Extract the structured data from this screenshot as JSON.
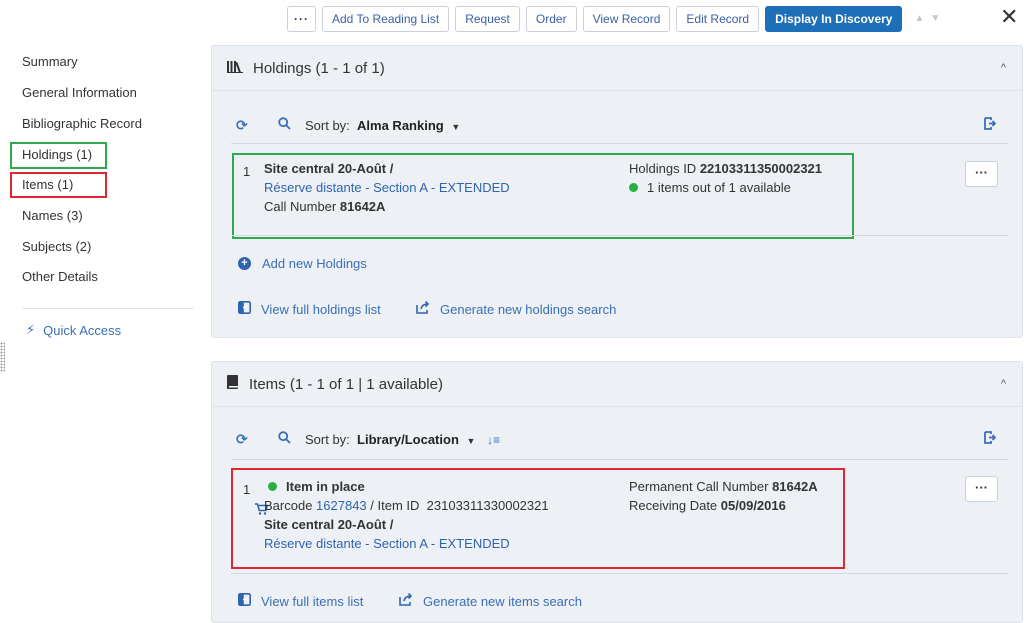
{
  "toolbar": {
    "more_label": "···",
    "buttons": [
      "Add To Reading List",
      "Request",
      "Order",
      "View Record",
      "Edit Record"
    ],
    "primary_label": "Display In Discovery",
    "close_label": "✕"
  },
  "sidebar": {
    "items": [
      "Summary",
      "General Information",
      "Bibliographic Record",
      "Holdings (1)",
      "Items (1)",
      "Names (3)",
      "Subjects (2)",
      "Other Details"
    ],
    "quick_access": "Quick Access"
  },
  "holdings": {
    "title": "Holdings (1 - 1 of 1)",
    "sort_label": "Sort by:",
    "sort_value": "Alma Ranking",
    "record": {
      "num": "1",
      "library": "Site central 20-Août /",
      "location": "Réserve distante - Section A - EXTENDED",
      "call_label": "Call Number",
      "call_value": "81642A",
      "id_label": "Holdings ID",
      "id_value": "22103311350002321",
      "availability": "1 items out of 1 available"
    },
    "add_new": "Add new Holdings",
    "view_full": "View full holdings list",
    "generate": "Generate new holdings search"
  },
  "items": {
    "title": "Items (1 - 1 of 1  |  1 available)",
    "sort_label": "Sort by:",
    "sort_value": "Library/Location",
    "record": {
      "num": "1",
      "status": "Item in place",
      "barcode_label": "Barcode",
      "barcode_value": "1627843",
      "itemid_label": "/ Item ID",
      "itemid_value": "23103311330002321",
      "library": "Site central 20-Août /",
      "location": "Réserve distante - Section A - EXTENDED",
      "perm_label": "Permanent Call Number",
      "perm_value": "81642A",
      "recv_label": "Receiving Date",
      "recv_value": "05/09/2016"
    },
    "view_full": "View full items list",
    "generate": "Generate new items search"
  },
  "colors": {
    "accent": "#1d6fb8",
    "link": "#2f64b0",
    "available": "#27b03f",
    "highlight_green": "#2fa84f",
    "highlight_red": "#e0262e"
  }
}
